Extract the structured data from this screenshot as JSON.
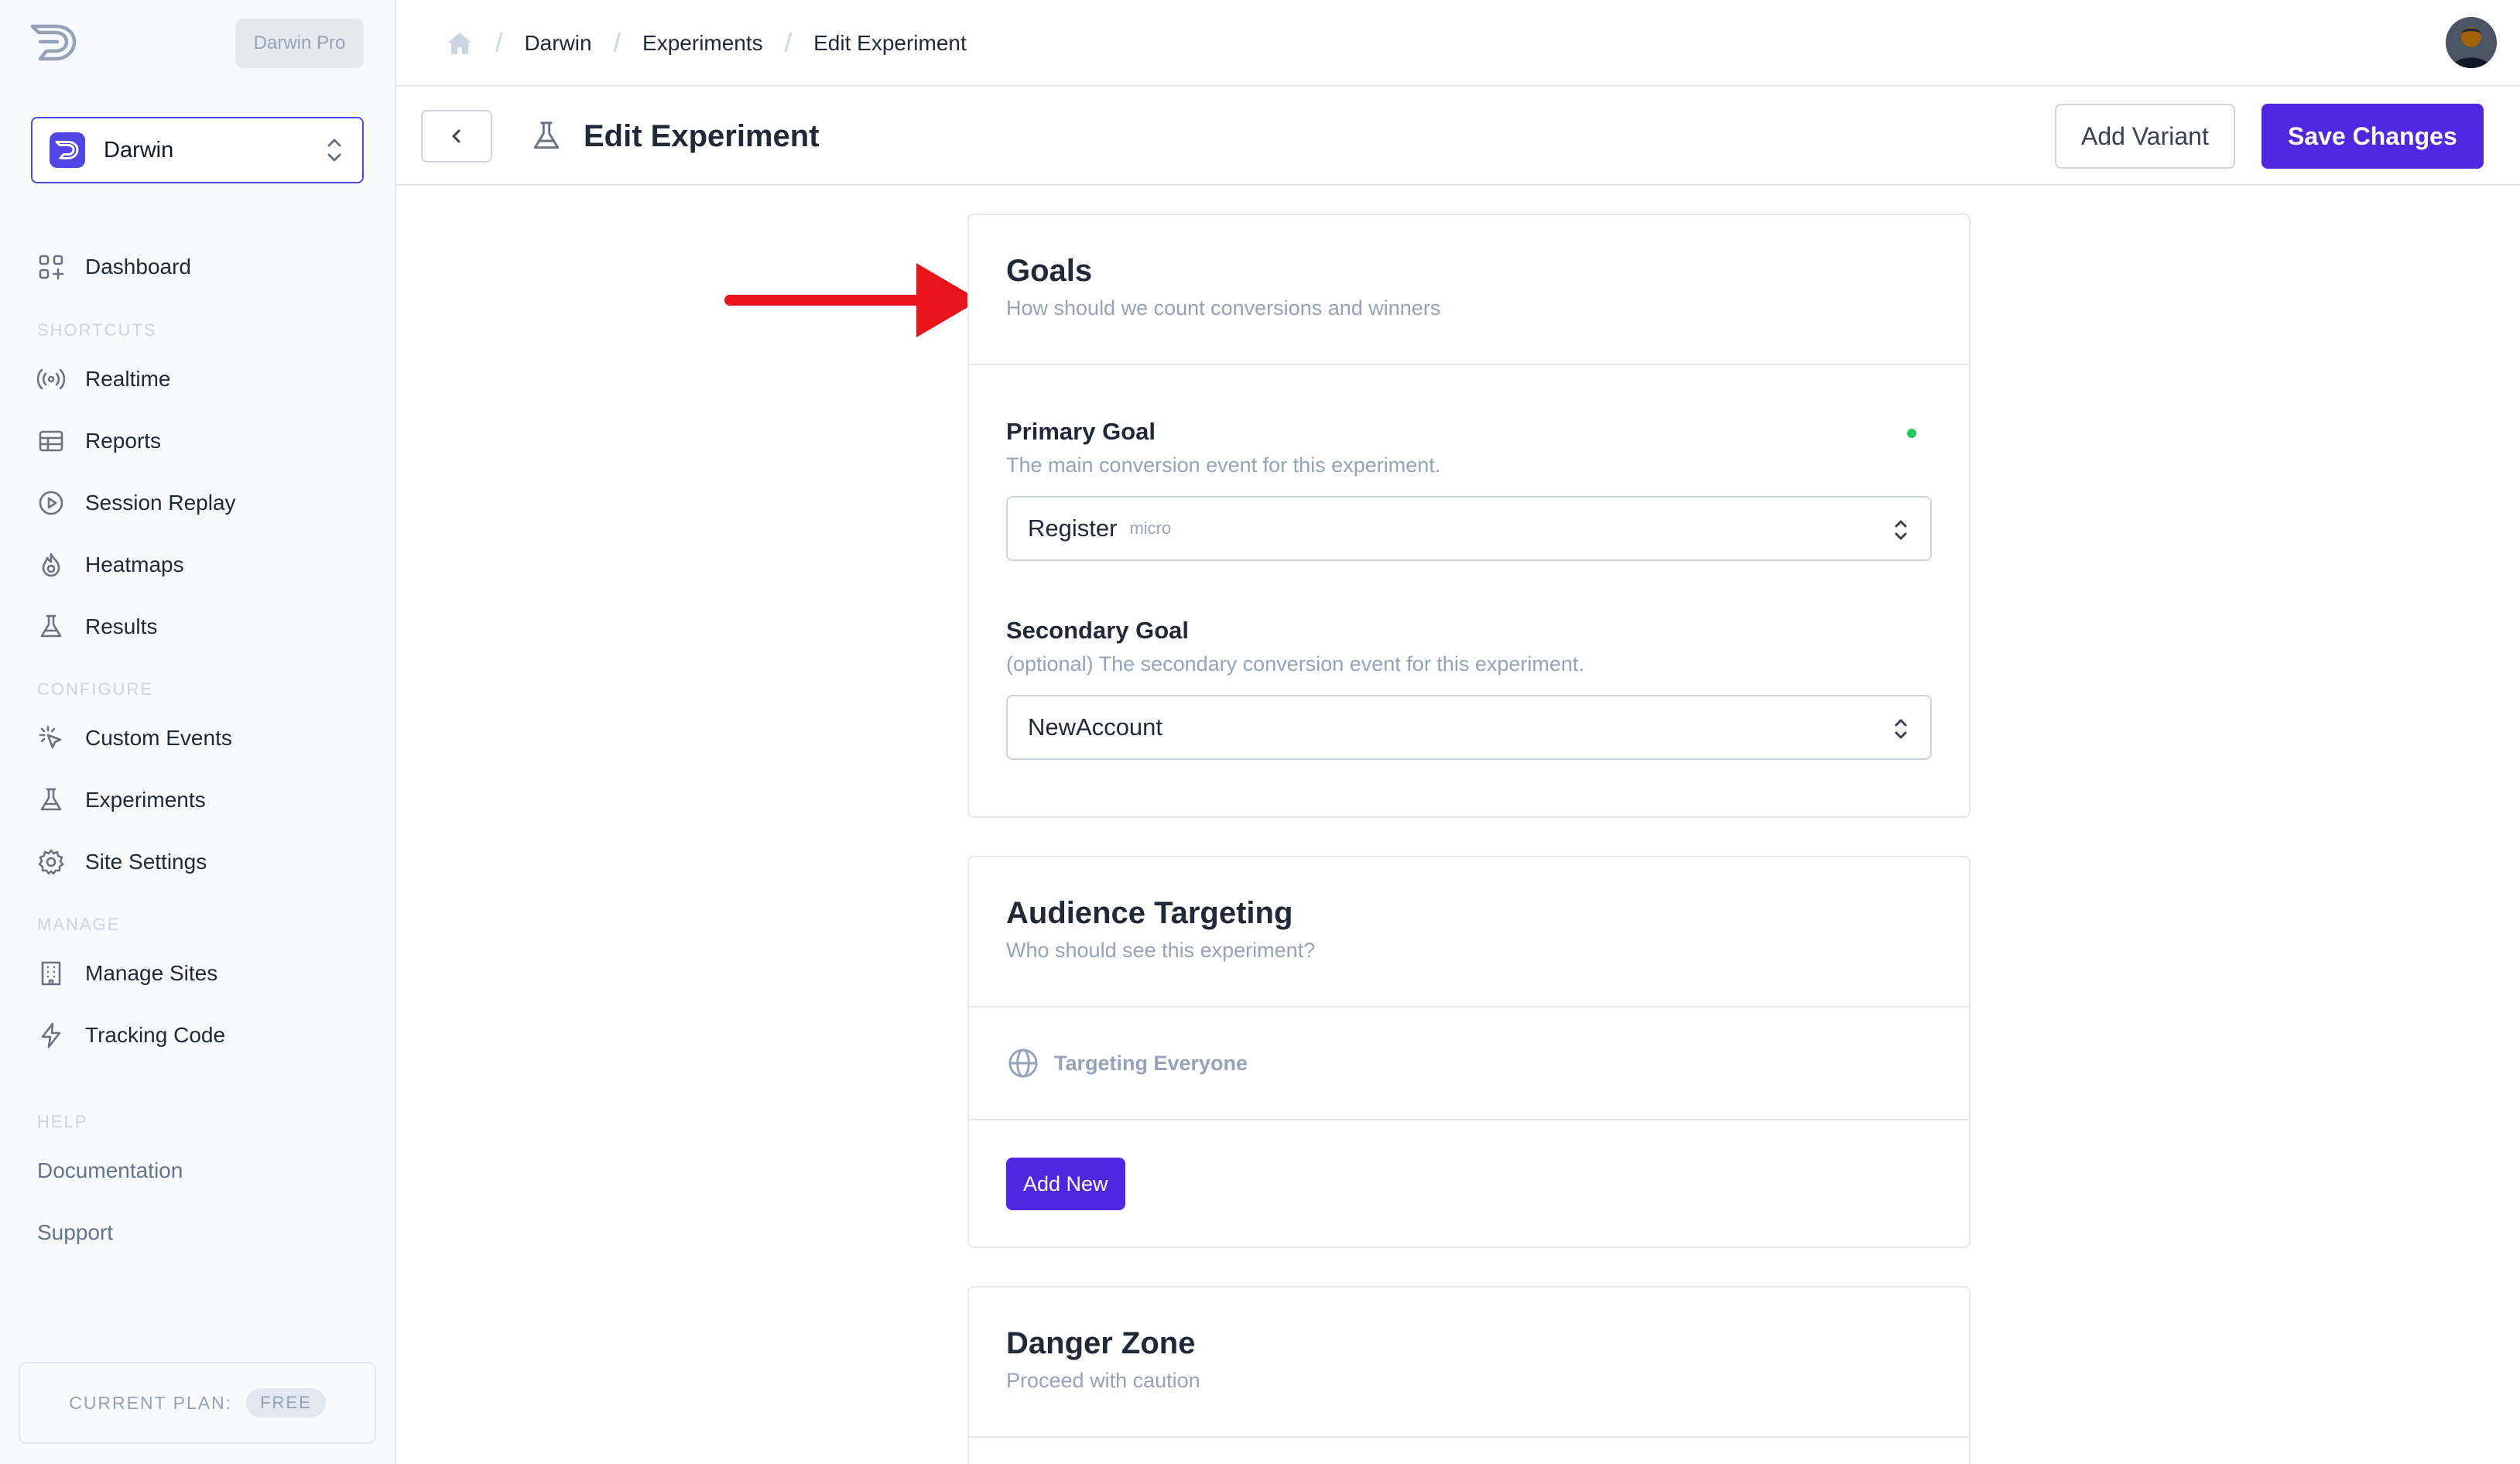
{
  "app": {
    "plan_badge": "Darwin Pro"
  },
  "site_switcher": {
    "name": "Darwin"
  },
  "sidebar": {
    "dashboard": "Dashboard",
    "sections": {
      "shortcuts": "SHORTCUTS",
      "configure": "CONFIGURE",
      "manage": "MANAGE",
      "help": "HELP"
    },
    "shortcuts": [
      "Realtime",
      "Reports",
      "Session Replay",
      "Heatmaps",
      "Results"
    ],
    "configure": [
      "Custom Events",
      "Experiments",
      "Site Settings"
    ],
    "manage": [
      "Manage Sites",
      "Tracking Code"
    ],
    "help": [
      "Documentation",
      "Support"
    ],
    "plan": {
      "label": "CURRENT PLAN:",
      "value": "FREE"
    }
  },
  "breadcrumb": [
    "Darwin",
    "Experiments",
    "Edit Experiment"
  ],
  "header": {
    "title": "Edit Experiment",
    "add_variant": "Add Variant",
    "save_changes": "Save Changes"
  },
  "goals": {
    "title": "Goals",
    "subtitle": "How should we count conversions and winners",
    "primary": {
      "label": "Primary Goal",
      "help": "The main conversion event for this experiment.",
      "value": "Register",
      "tag": "micro"
    },
    "secondary": {
      "label": "Secondary Goal",
      "help": "(optional) The secondary conversion event for this experiment.",
      "value": "NewAccount"
    }
  },
  "audience": {
    "title": "Audience Targeting",
    "subtitle": "Who should see this experiment?",
    "targeting": "Targeting Everyone",
    "add_new": "Add New"
  },
  "danger": {
    "title": "Danger Zone",
    "subtitle": "Proceed with caution"
  },
  "colors": {
    "primary": "#4f27e0",
    "annotation_arrow": "#e8131b",
    "status_dot": "#22c55e"
  }
}
